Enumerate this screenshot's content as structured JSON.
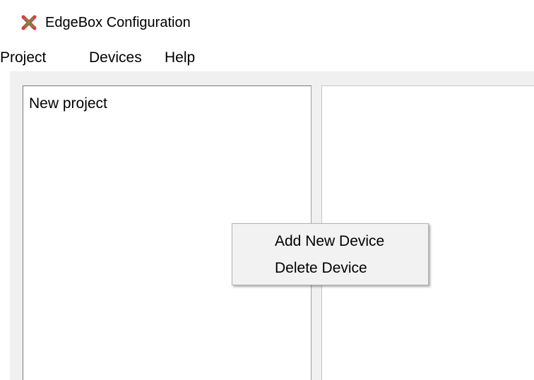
{
  "window": {
    "title": "EdgeBox Configuration",
    "icon": "edgebox-x-icon",
    "colors": {
      "icon_primary": "#e8323c",
      "icon_secondary": "#2db84d"
    }
  },
  "menubar": {
    "items": [
      {
        "label": "Project"
      },
      {
        "label": "Devices"
      },
      {
        "label": "Help"
      }
    ]
  },
  "tree": {
    "items": [
      {
        "label": "New project"
      }
    ]
  },
  "context_menu": {
    "items": [
      {
        "label": "Add New Device"
      },
      {
        "label": "Delete Device"
      }
    ]
  }
}
